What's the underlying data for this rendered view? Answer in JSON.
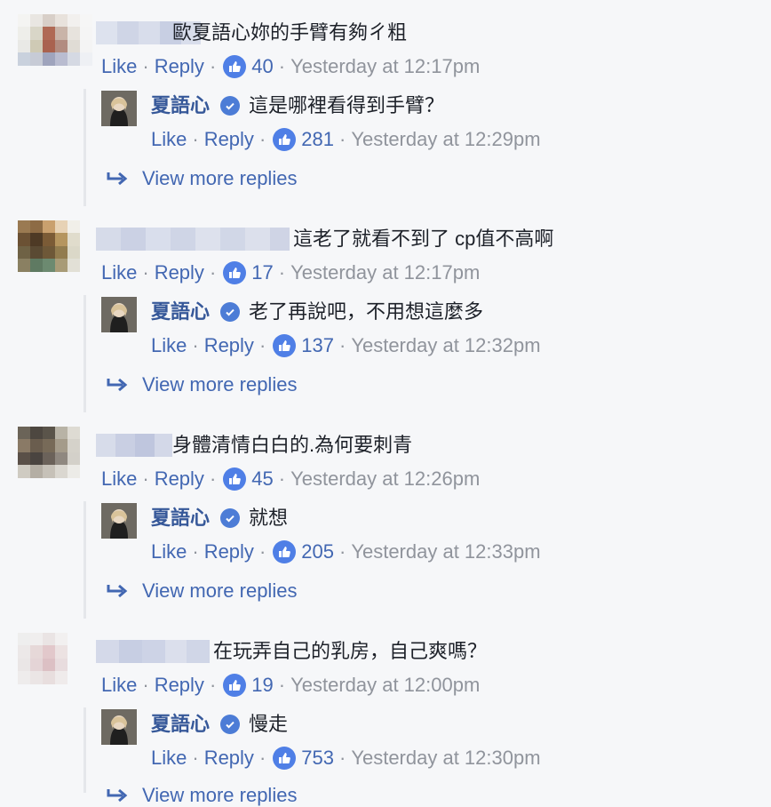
{
  "colors": {
    "link": "#4267b2",
    "meta": "#90949c",
    "text": "#1d2129",
    "name": "#365899",
    "like_badge": "#4f7fe6"
  },
  "icons": {
    "like": "thumbs-up-icon",
    "verified": "verified-badge-icon",
    "reply_arrow": "reply-arrow-icon"
  },
  "labels": {
    "like": "Like",
    "reply": "Reply",
    "view_more": "View more replies",
    "separator": "·"
  },
  "threads": [
    {
      "comment": {
        "text": "歐夏語心妳的手臂有夠ㄔ粗",
        "likes": "40",
        "time": "Yesterday at 12:17pm"
      },
      "reply": {
        "author": "夏語心",
        "text": "這是哪裡看得到手臂？",
        "likes": "281",
        "time": "Yesterday at 12:29pm"
      }
    },
    {
      "comment": {
        "text": "這老了就看不到了 cp值不高啊",
        "likes": "17",
        "time": "Yesterday at 12:17pm"
      },
      "reply": {
        "author": "夏語心",
        "text": "老了再說吧，不用想這麼多",
        "likes": "137",
        "time": "Yesterday at 12:32pm"
      }
    },
    {
      "comment": {
        "text": "身體清情白白的.為何要刺青",
        "likes": "45",
        "time": "Yesterday at 12:26pm"
      },
      "reply": {
        "author": "夏語心",
        "text": "就想",
        "likes": "205",
        "time": "Yesterday at 12:33pm"
      }
    },
    {
      "comment": {
        "text": "在玩弄自己的乳房，自己爽嗎？",
        "likes": "19",
        "time": "Yesterday at 12:00pm"
      },
      "reply": {
        "author": "夏語心",
        "text": "慢走",
        "likes": "753",
        "time": "Yesterday at 12:30pm"
      }
    }
  ]
}
